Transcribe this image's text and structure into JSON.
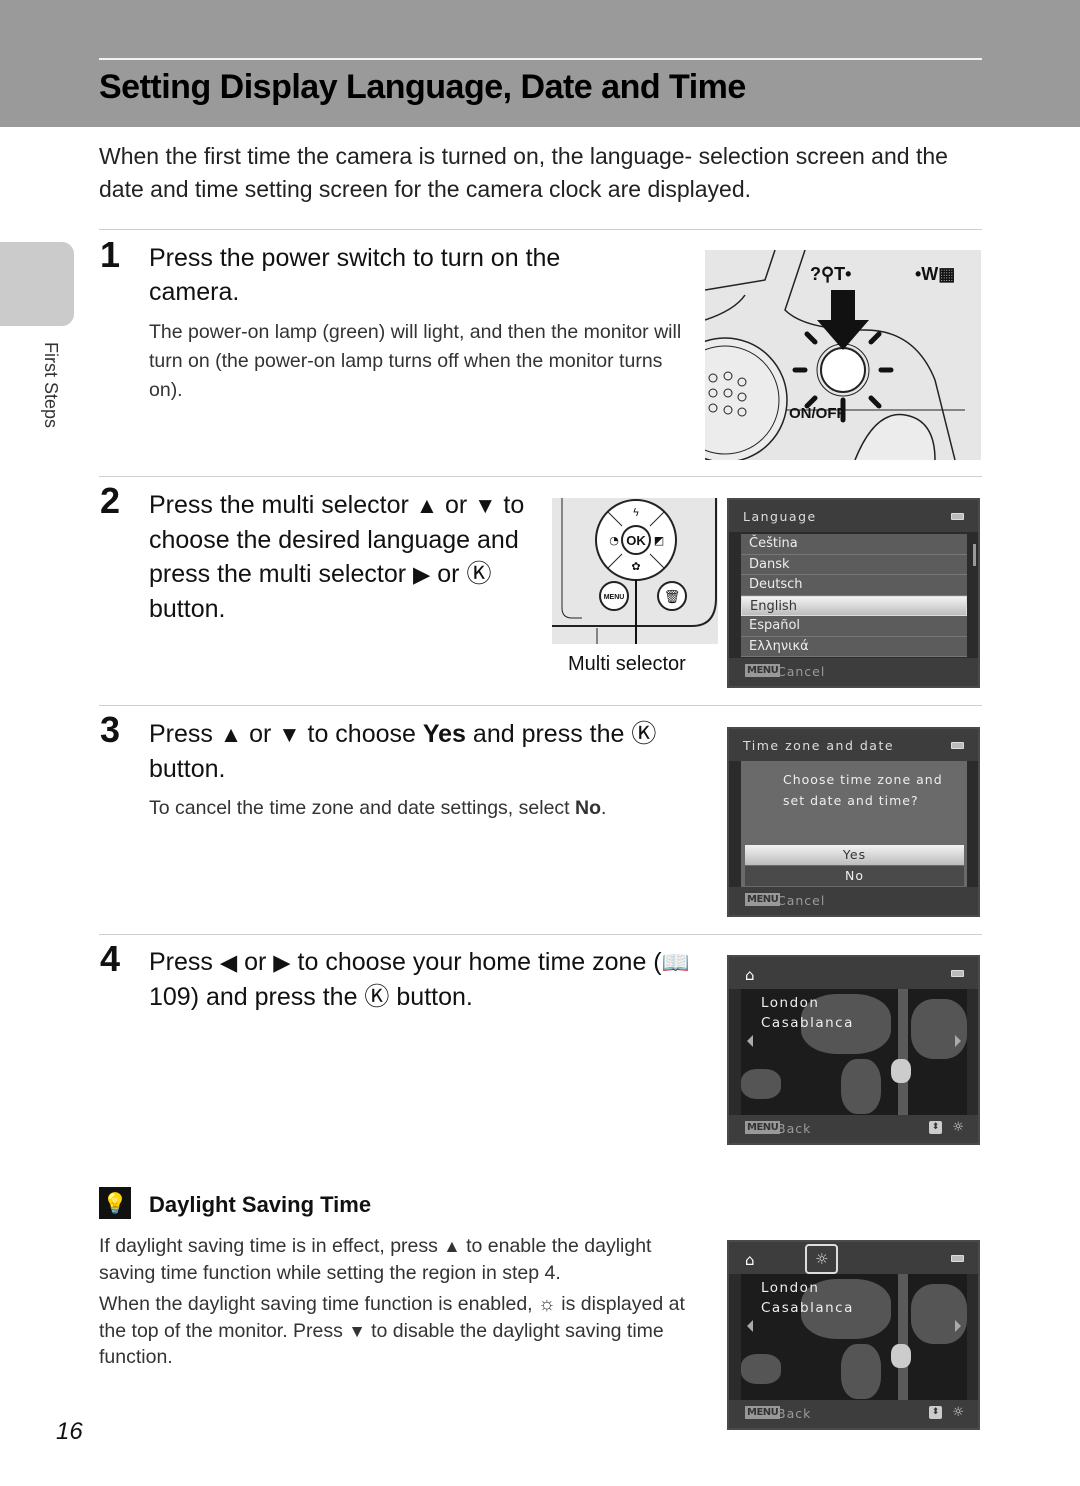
{
  "header": {
    "title": "Setting Display Language, Date and Time"
  },
  "intro": "When the first time the camera is turned on, the language- selection screen and the date and time setting screen for the camera clock are displayed.",
  "side_tab": {
    "label": "First Steps"
  },
  "steps": [
    {
      "number": "1",
      "text": "Press the power switch to turn on the camera.",
      "sub": "The power-on lamp (green) will light, and then the monitor will turn on (the power-on lamp turns off when the monitor turns on).",
      "illustration": {
        "labels": [
          "?",
          "T",
          "W"
        ],
        "switch_label": "ON/OFF"
      }
    },
    {
      "number": "2",
      "text_parts": [
        "Press the multi selector ",
        "▲",
        " or ",
        "▼",
        " to choose the desired language and press the multi selector ",
        "▶",
        " or ",
        "Ⓚ",
        " button."
      ],
      "caption": "Multi selector",
      "selector_labels": {
        "ok": "OK",
        "menu": "MENU"
      },
      "screen": {
        "title": "Language",
        "items": [
          "Čeština",
          "Dansk",
          "Deutsch",
          "English",
          "Español",
          "Ελληνικά"
        ],
        "selected": "English",
        "menu_badge": "MENU",
        "footer": "Cancel"
      }
    },
    {
      "number": "3",
      "text_parts": [
        "Press ",
        "▲",
        " or ",
        "▼",
        " to choose ",
        "Yes",
        " and press the ",
        "Ⓚ",
        " button."
      ],
      "sub_parts": [
        "To cancel the time zone and date settings, select ",
        "No",
        "."
      ],
      "screen": {
        "title": "Time zone and date",
        "question_line1": "Choose time zone and",
        "question_line2": "set date and time?",
        "options": [
          "Yes",
          "No"
        ],
        "selected": "Yes",
        "menu_badge": "MENU",
        "footer": "Cancel"
      }
    },
    {
      "number": "4",
      "text_parts": [
        "Press ",
        "◀",
        " or ",
        "▶",
        " to choose your home time zone (",
        "📖",
        " 109) and press the ",
        "Ⓚ",
        " button."
      ],
      "screen": {
        "cities": [
          "London",
          "Casablanca"
        ],
        "menu_badge": "MENU",
        "footer": "Back"
      }
    }
  ],
  "tip": {
    "title": "Daylight Saving Time",
    "para1_parts": [
      "If daylight saving time is in effect, press ",
      "▲",
      " to enable the daylight saving time function while setting the region in step 4."
    ],
    "para2_parts": [
      "When the daylight saving time function is enabled, ",
      "☼",
      " is displayed at the top of the monitor. Press ",
      "▼",
      " to disable the daylight saving time function."
    ],
    "screen": {
      "cities": [
        "London",
        "Casablanca"
      ],
      "menu_badge": "MENU",
      "footer": "Back"
    }
  },
  "page_number": "16"
}
